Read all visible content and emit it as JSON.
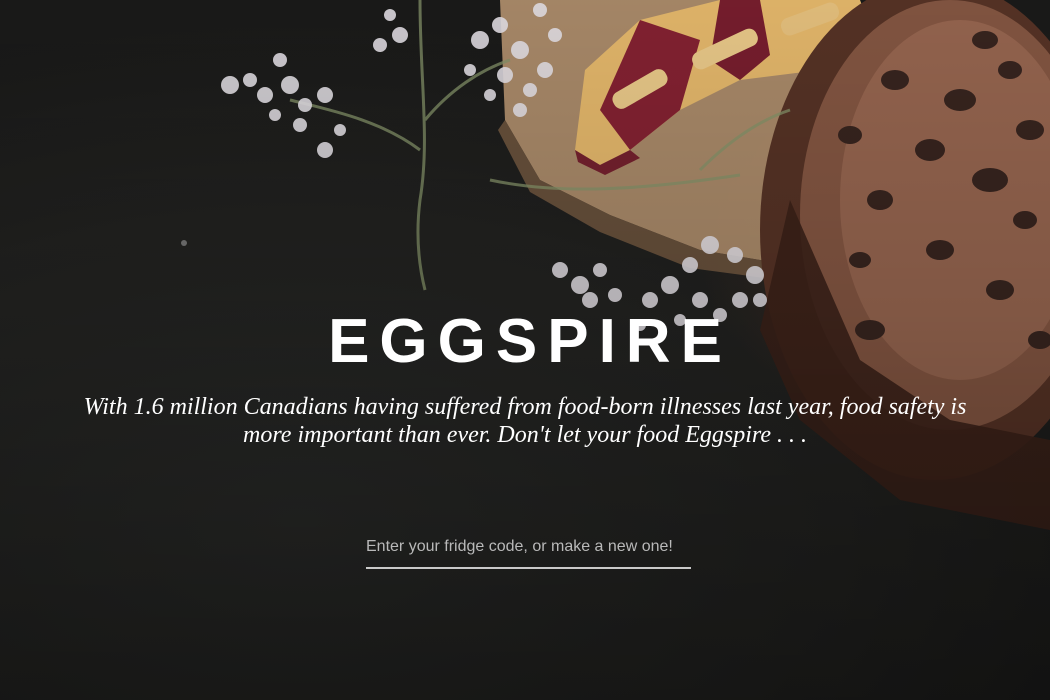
{
  "hero": {
    "title": "EGGSPIRE",
    "tagline": "With 1.6 million Canadians having suffered from food-born illnesses last year, food safety is more important than ever. Don't let your food Eggspire . . ."
  },
  "fridge_code": {
    "placeholder": "Enter your fridge code, or make a new one!",
    "value": ""
  },
  "colors": {
    "background": "#1f1f1d",
    "title_text": "#ffffff",
    "input_underline": "#c9c9c9",
    "placeholder_text": "#b9b9b9"
  }
}
